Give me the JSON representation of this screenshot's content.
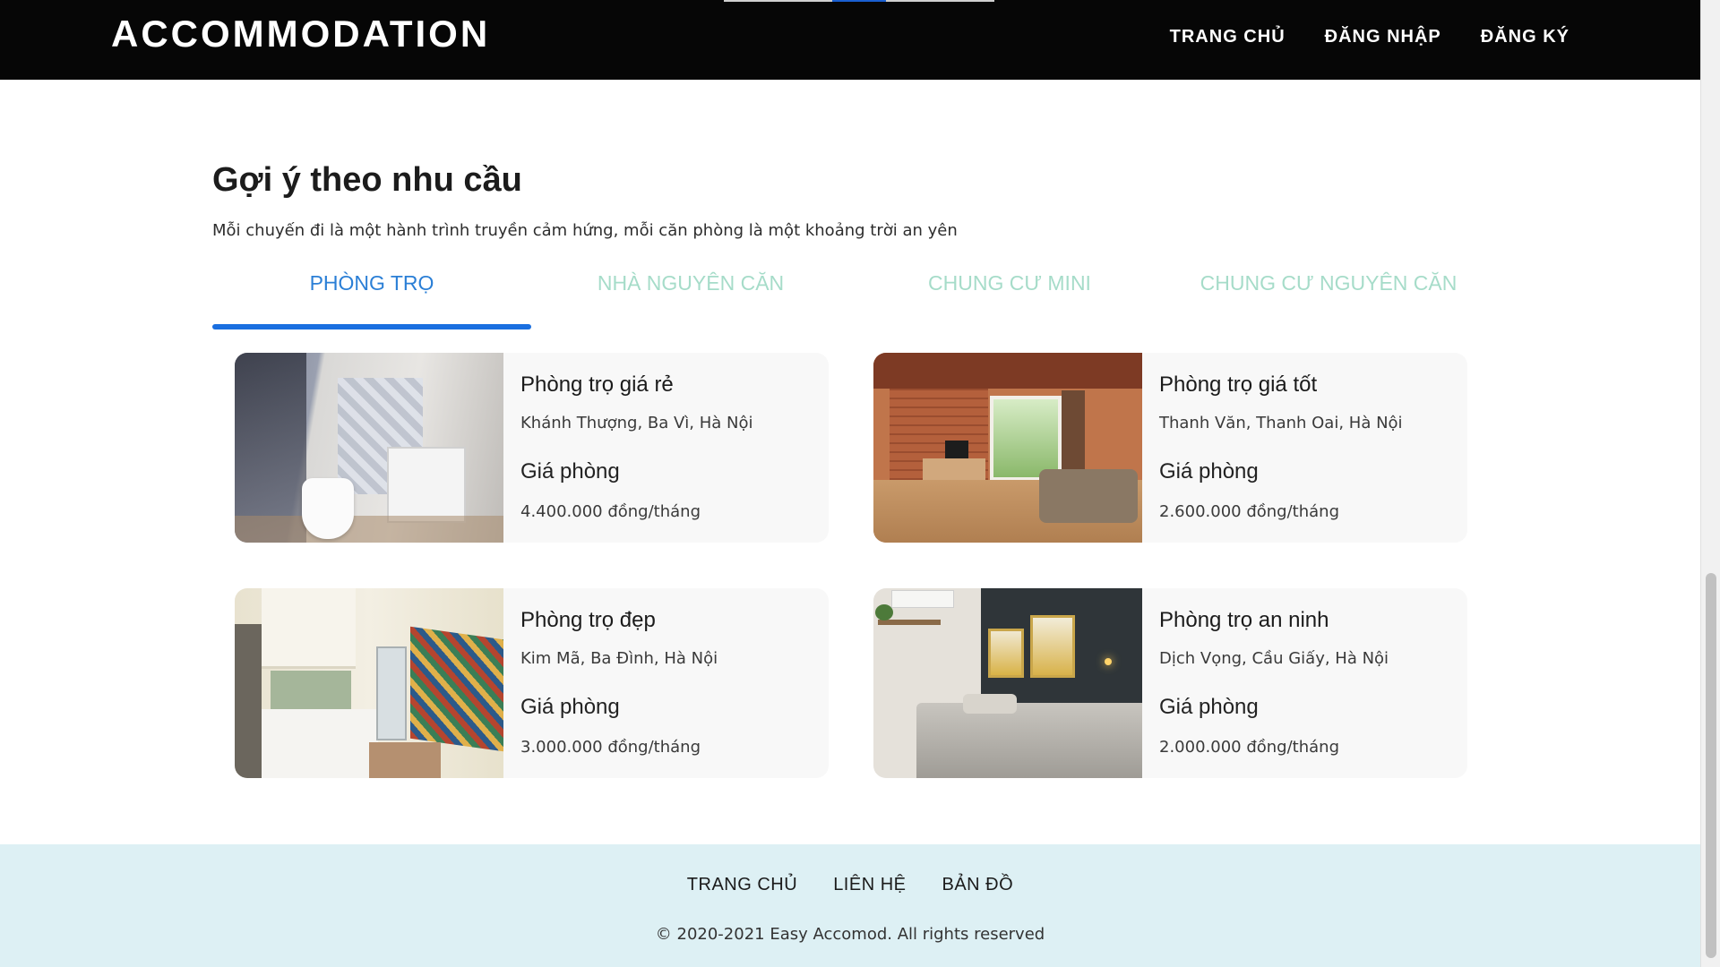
{
  "header": {
    "brand": "ACCOMMODATION",
    "nav": [
      "TRANG CHỦ",
      "ĐĂNG NHẬP",
      "ĐĂNG KÝ"
    ]
  },
  "section": {
    "title": "Gợi ý theo nhu cầu",
    "subtitle": "Mỗi chuyến đi là một hành trình truyền cảm hứng, mỗi căn phòng là một khoảng trời an yên"
  },
  "tabs": [
    {
      "label": "PHÒNG TRỌ",
      "active": true
    },
    {
      "label": "NHÀ NGUYÊN CĂN",
      "active": false
    },
    {
      "label": "CHUNG CƯ MINI",
      "active": false
    },
    {
      "label": "CHUNG CƯ NGUYÊN CĂN",
      "active": false
    }
  ],
  "listings": [
    {
      "title": "Phòng trọ giá rẻ",
      "address": "Khánh Thượng, Ba Vì, Hà Nội",
      "price_label": "Giá phòng",
      "price": "4.400.000 đồng/tháng"
    },
    {
      "title": "Phòng trọ giá tốt",
      "address": "Thanh Văn, Thanh Oai, Hà Nội",
      "price_label": "Giá phòng",
      "price": "2.600.000 đồng/tháng"
    },
    {
      "title": "Phòng trọ đẹp",
      "address": "Kim Mã, Ba Đình, Hà Nội",
      "price_label": "Giá phòng",
      "price": "3.000.000 đồng/tháng"
    },
    {
      "title": "Phòng trọ an ninh",
      "address": "Dịch Vọng, Cầu Giấy, Hà Nội",
      "price_label": "Giá phòng",
      "price": "2.000.000 đồng/tháng"
    }
  ],
  "footer": {
    "nav": [
      "TRANG CHỦ",
      "LIÊN HỆ",
      "BẢN ĐỒ"
    ],
    "copyright": "© 2020-2021 Easy Accomod. All rights reserved"
  },
  "colors": {
    "header_bg": "#060606",
    "tab_active": "#2b7fd6",
    "tab_inactive": "#a6dcc9",
    "footer_bg": "#ddf0f4"
  }
}
